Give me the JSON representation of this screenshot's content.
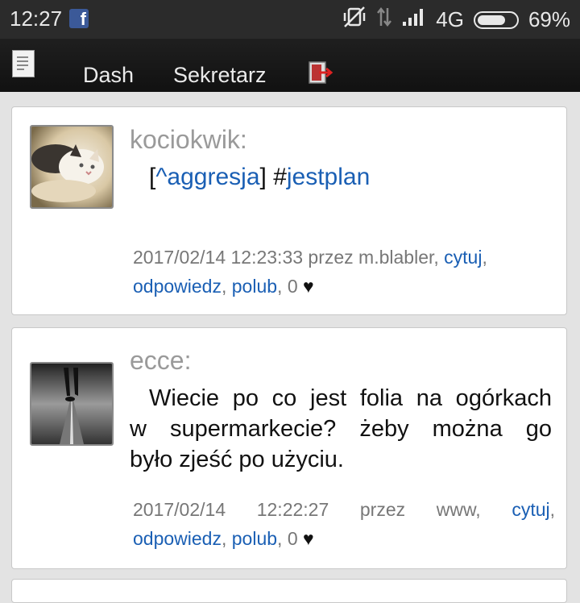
{
  "status_bar": {
    "time": "12:27",
    "app_icon": "facebook-icon",
    "network": "4G",
    "battery": "69%"
  },
  "nav": {
    "menu_icon": "document-icon",
    "dash_label": "Dash",
    "sekretarz_label": "Sekretarz",
    "logout_icon": "logout-icon"
  },
  "posts": [
    {
      "author": "kociokwik:",
      "message_bracket_open": "[",
      "tag_link": "^aggresja",
      "message_bracket_close": "]",
      "hash_prefix": "#",
      "hashtag_link": "jestplan",
      "meta_line1": "2017/02/14 12:23:33 przez m.blabler,",
      "quote_label": "cytuj",
      "reply_label": "odpowiedz",
      "like_label": "polub",
      "likes_count": "0",
      "heart": "♥"
    },
    {
      "author": "ecce:",
      "message_line1": "Wiecie po co jest folia na ogórkach",
      "message_line2": "w supermarkecie? żeby można go",
      "message_line3": "było zjeść po użyciu.",
      "meta_line1": "2017/02/14 12:22:27 przez www,",
      "quote_label": "cytuj",
      "reply_label": "odpowiedz",
      "like_label": "polub",
      "likes_count": "0",
      "heart": "♥"
    }
  ]
}
